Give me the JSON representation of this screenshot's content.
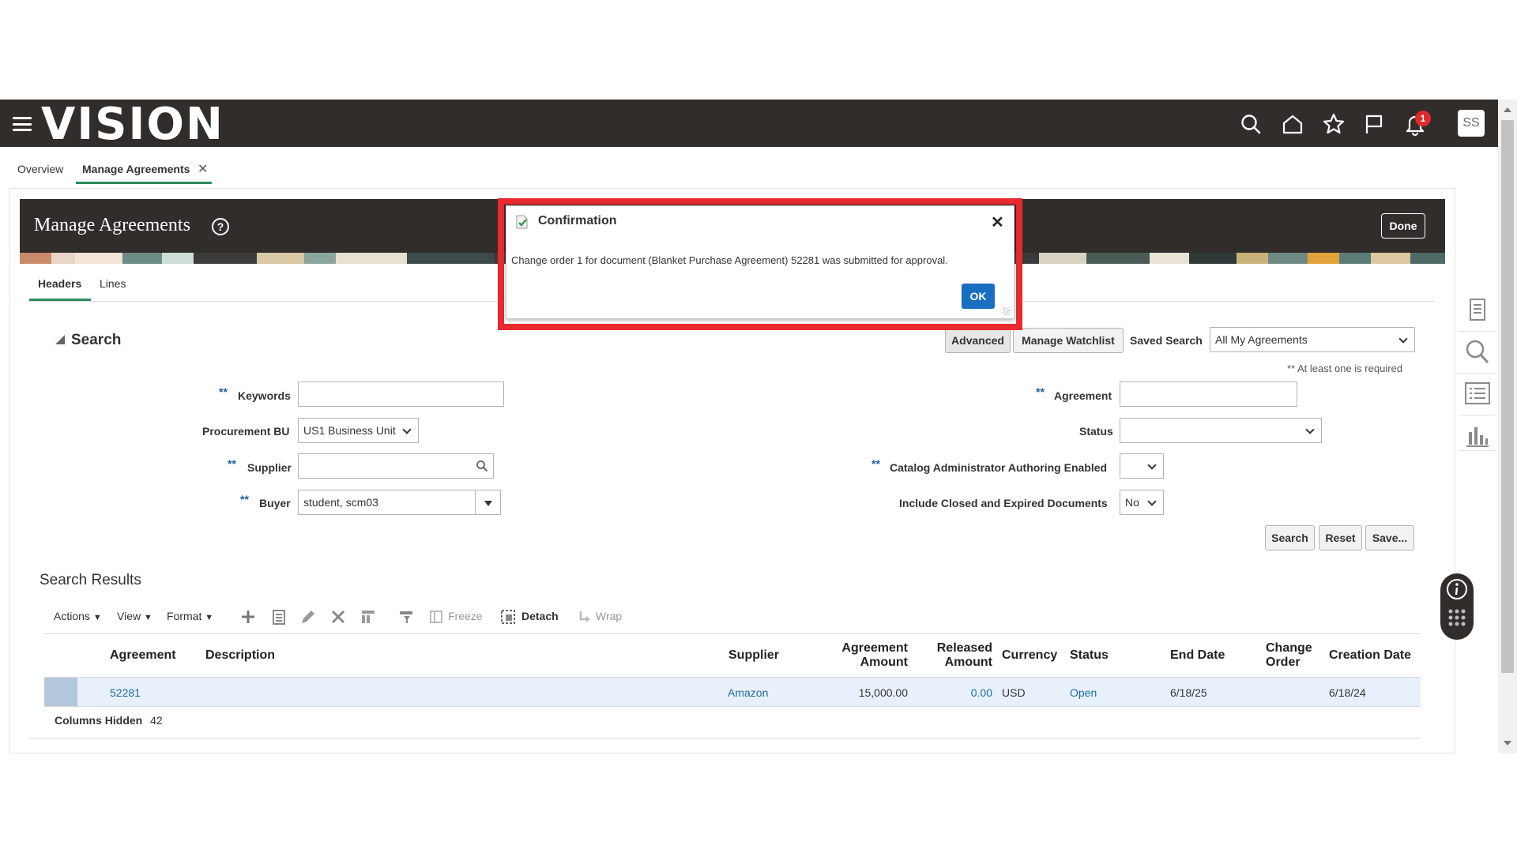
{
  "app": {
    "logo": "VISION",
    "user_initials": "SS",
    "notification_count": "1"
  },
  "tabs": [
    {
      "label": "Overview"
    },
    {
      "label": "Manage Agreements"
    }
  ],
  "page": {
    "title": "Manage Agreements",
    "done_label": "Done",
    "help_label": "?"
  },
  "inner_tabs": [
    {
      "label": "Headers"
    },
    {
      "label": "Lines"
    }
  ],
  "search": {
    "title": "Search",
    "required_marker": "**",
    "required_note": "** At least one is required",
    "advanced_label": "Advanced",
    "watchlist_label": "Manage Watchlist",
    "saved_search_label": "Saved Search",
    "saved_search_value": "All My Agreements",
    "fields": {
      "keywords": {
        "label": "Keywords",
        "value": ""
      },
      "procurement_bu": {
        "label": "Procurement BU",
        "value": "US1 Business Unit"
      },
      "supplier": {
        "label": "Supplier",
        "value": ""
      },
      "buyer": {
        "label": "Buyer",
        "value": "student, scm03"
      },
      "agreement": {
        "label": "Agreement",
        "value": ""
      },
      "status": {
        "label": "Status",
        "value": ""
      },
      "catalog_admin": {
        "label": "Catalog Administrator Authoring Enabled",
        "value": ""
      },
      "include_closed": {
        "label": "Include Closed and Expired Documents",
        "value": "No"
      }
    },
    "search_btn": "Search",
    "reset_btn": "Reset",
    "save_btn": "Save..."
  },
  "results": {
    "title": "Search Results",
    "toolbar": {
      "actions": "Actions",
      "view": "View",
      "format": "Format",
      "freeze": "Freeze",
      "detach": "Detach",
      "wrap": "Wrap"
    },
    "columns": {
      "agreement": "Agreement",
      "description": "Description",
      "supplier": "Supplier",
      "agreement_amount_1": "Agreement",
      "agreement_amount_2": "Amount",
      "released_amount_1": "Released",
      "released_amount_2": "Amount",
      "currency": "Currency",
      "status": "Status",
      "end_date": "End Date",
      "change_order_1": "Change",
      "change_order_2": "Order",
      "creation_date": "Creation Date"
    },
    "rows": [
      {
        "agreement": "52281",
        "description": "",
        "supplier": "Amazon",
        "agreement_amount": "15,000.00",
        "released_amount": "0.00",
        "currency": "USD",
        "status": "Open",
        "end_date": "6/18/25",
        "change_order": "",
        "creation_date": "6/18/24"
      }
    ],
    "columns_hidden_label": "Columns Hidden",
    "columns_hidden_count": "42"
  },
  "modal": {
    "title": "Confirmation",
    "message": "Change order 1 for document (Blanket Purchase Agreement) 52281 was submitted for approval.",
    "ok_label": "OK",
    "close_symbol": "✕"
  },
  "colors": {
    "accent": "#1a6ec2",
    "header_bg": "#312d2a",
    "highlight": "#e8292d"
  }
}
